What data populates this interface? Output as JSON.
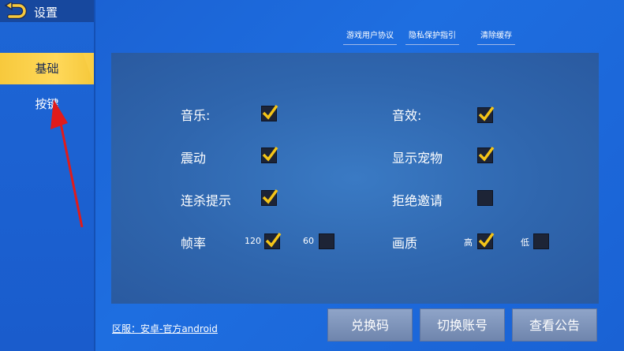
{
  "window": {
    "title": "设置"
  },
  "sidebar": {
    "items": [
      {
        "label": "基础",
        "active": true
      },
      {
        "label": "按键",
        "active": false
      }
    ]
  },
  "header_links": [
    {
      "label": "游戏用户协议"
    },
    {
      "label": "隐私保护指引"
    },
    {
      "label": "清除缓存"
    }
  ],
  "settings": {
    "music": {
      "label": "音乐:",
      "checked": true
    },
    "sound_effects": {
      "label": "音效:",
      "checked": true
    },
    "vibration": {
      "label": "震动",
      "checked": true
    },
    "show_pet": {
      "label": "显示宠物",
      "checked": true
    },
    "kill_tips": {
      "label": "连杀提示",
      "checked": true
    },
    "reject_invites": {
      "label": "拒绝邀请",
      "checked": false
    },
    "frame_rate": {
      "label": "帧率",
      "options": [
        {
          "label": "120",
          "checked": true
        },
        {
          "label": "60",
          "checked": false
        }
      ]
    },
    "quality": {
      "label": "画质",
      "options": [
        {
          "label": "高",
          "checked": true
        },
        {
          "label": "低",
          "checked": false
        }
      ]
    }
  },
  "footer": {
    "server": "区服：安卓-官方android",
    "buttons": [
      {
        "label": "兑换码"
      },
      {
        "label": "切换账号"
      },
      {
        "label": "查看公告"
      }
    ]
  },
  "colors": {
    "accent": "#f7c93c",
    "checkmark": "#f5c518",
    "annotation_arrow": "#e01b1b"
  }
}
